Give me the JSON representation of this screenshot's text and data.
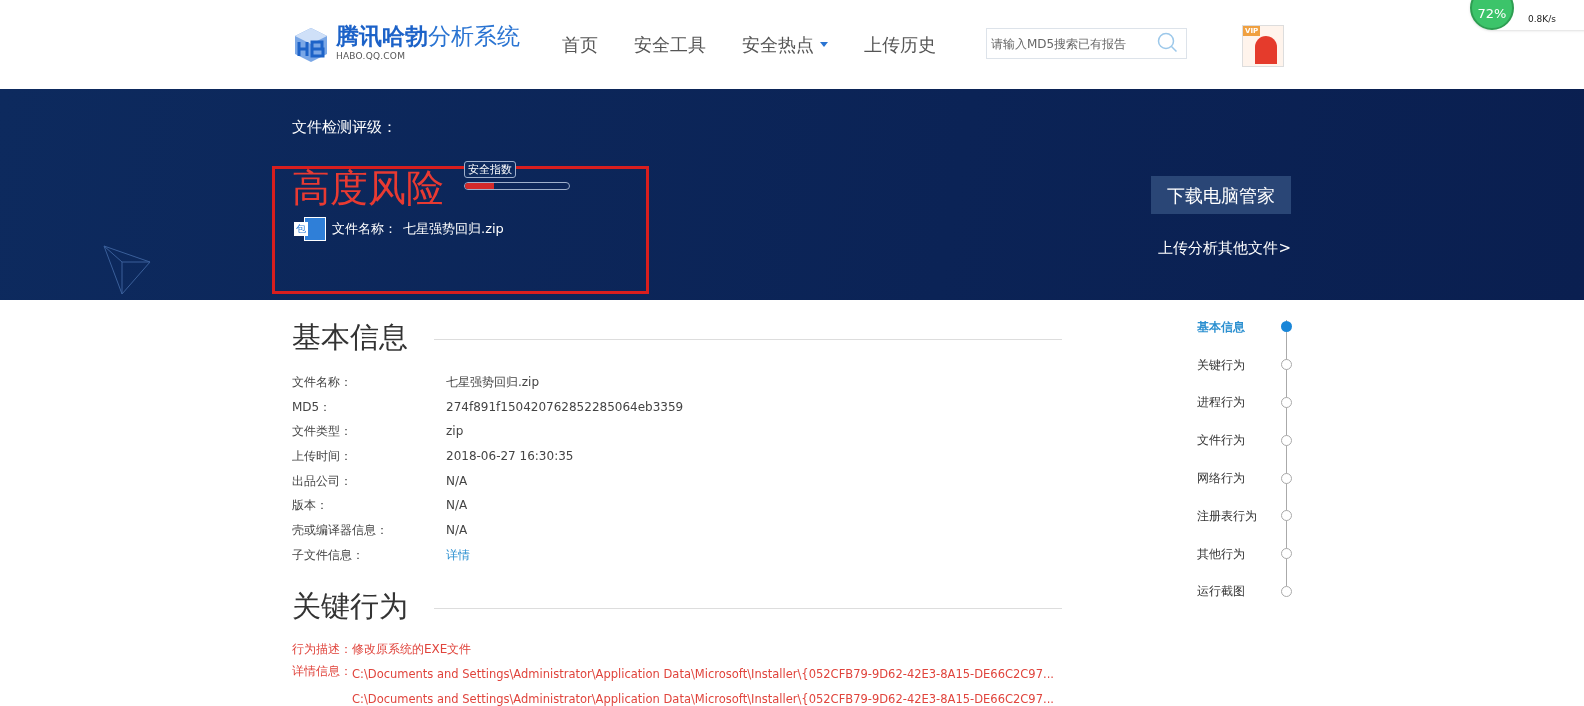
{
  "header": {
    "logo_title": "腾讯哈勃",
    "logo_subtitle": "分析系统",
    "logo_domain": "HABO.QQ.COM",
    "nav": [
      {
        "label": "首页",
        "dropdown": false
      },
      {
        "label": "安全工具",
        "dropdown": false
      },
      {
        "label": "安全热点",
        "dropdown": true
      },
      {
        "label": "上传历史",
        "dropdown": false
      }
    ],
    "search": {
      "placeholder": "请输入MD5搜索已有报告"
    },
    "user_badge": "VIP"
  },
  "overlay_widget": {
    "percent": "72%",
    "speed": "0.8K/s"
  },
  "banner": {
    "heading": "文件检测评级：",
    "risk": "高度风险",
    "index_tooltip": "安全指数",
    "index_bar": {
      "level": 0.28
    },
    "file_label": "文件名称：",
    "file_name": "七星强势回归.zip",
    "file_icon_text": "包",
    "download_button": "下载电脑管家",
    "upload_link": "上传分析其他文件>"
  },
  "basic_info": {
    "title": "基本信息",
    "rows": [
      {
        "label": "文件名称：",
        "value": "七星强势回归.zip",
        "kind": "text"
      },
      {
        "label": "MD5：",
        "value": "274f891f150420762852285064eb3359",
        "kind": "text"
      },
      {
        "label": "文件类型：",
        "value": "zip",
        "kind": "text"
      },
      {
        "label": "上传时间：",
        "value": "2018-06-27 16:30:35",
        "kind": "text"
      },
      {
        "label": "出品公司：",
        "value": "N/A",
        "kind": "text"
      },
      {
        "label": "版本：",
        "value": "N/A",
        "kind": "text"
      },
      {
        "label": "壳或编译器信息：",
        "value": "N/A",
        "kind": "text"
      },
      {
        "label": "子文件信息：",
        "value": "详情",
        "kind": "link"
      }
    ]
  },
  "key_behavior": {
    "title": "关键行为",
    "description_label": "行为描述：",
    "description": "修改原系统的EXE文件",
    "details_label": "详情信息：",
    "details": [
      "C:\\Documents and Settings\\Administrator\\Application Data\\Microsoft\\Installer\\{052CFB79-9D62-42E3-8A15-DE66C2C97...",
      "C:\\Documents and Settings\\Administrator\\Application Data\\Microsoft\\Installer\\{052CFB79-9D62-42E3-8A15-DE66C2C97..."
    ]
  },
  "side_nav": [
    {
      "label": "基本信息",
      "selected": true
    },
    {
      "label": "关键行为",
      "selected": false
    },
    {
      "label": "进程行为",
      "selected": false
    },
    {
      "label": "文件行为",
      "selected": false
    },
    {
      "label": "网络行为",
      "selected": false
    },
    {
      "label": "注册表行为",
      "selected": false
    },
    {
      "label": "其他行为",
      "selected": false
    },
    {
      "label": "运行截图",
      "selected": false
    }
  ]
}
